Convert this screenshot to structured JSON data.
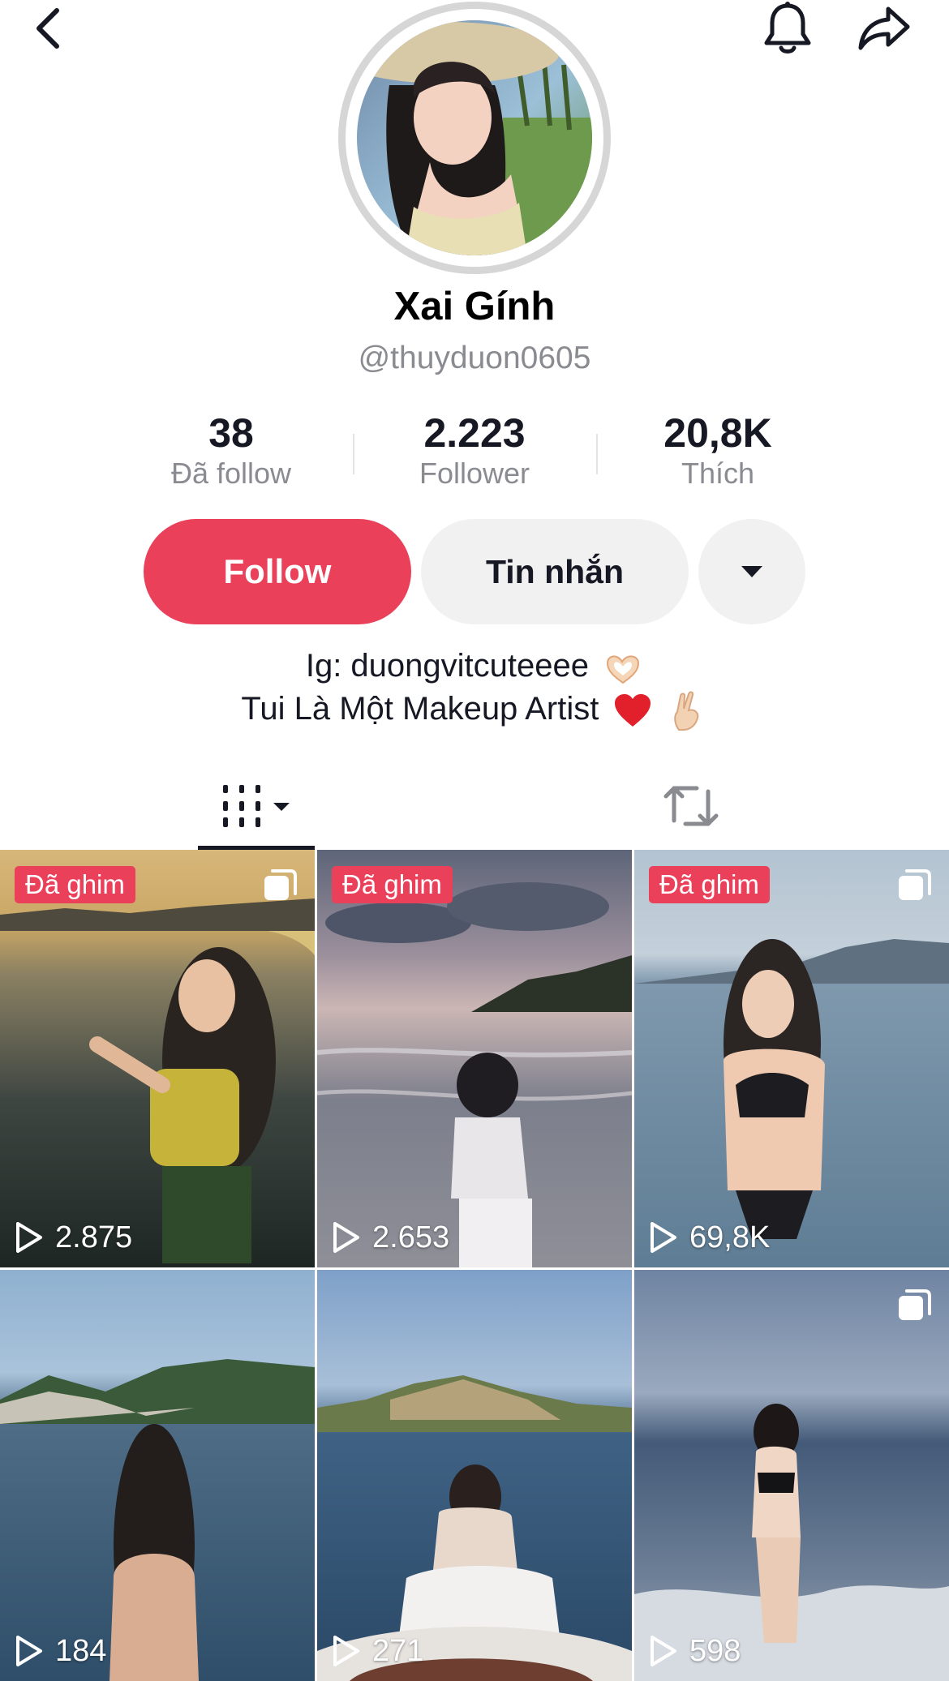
{
  "header": {
    "back_icon": "chevron-left-icon",
    "bell_icon": "bell-icon",
    "share_icon": "share-arrow-icon"
  },
  "profile": {
    "display_name": "Xai Gính",
    "handle": "@thuyduon0605",
    "avatar": "profile-photo"
  },
  "stats": [
    {
      "value": "38",
      "label": "Đã follow"
    },
    {
      "value": "2.223",
      "label": "Follower"
    },
    {
      "value": "20,8K",
      "label": "Thích"
    }
  ],
  "actions": {
    "follow_label": "Follow",
    "message_label": "Tin nhắn",
    "more_icon": "caret-down-icon"
  },
  "bio": {
    "line1": "Ig: duongvitcuteeee",
    "line1_emoji": "heart-hands-emoji",
    "line2": "Tui Là Một Makeup Artist",
    "line2_emoji": [
      "red-heart-emoji",
      "crossed-fingers-emoji"
    ]
  },
  "tabs": [
    {
      "name": "videos",
      "icon": "grid-lines-icon",
      "has_dropdown": true,
      "active": true
    },
    {
      "name": "reposts",
      "icon": "repost-icon",
      "active": false
    }
  ],
  "videos": [
    {
      "views": "2.875",
      "pinned": true,
      "pin_label": "Đã ghim",
      "multi": true
    },
    {
      "views": "2.653",
      "pinned": true,
      "pin_label": "Đã ghim",
      "multi": false
    },
    {
      "views": "69,8K",
      "pinned": true,
      "pin_label": "Đã ghim",
      "multi": true
    },
    {
      "views": "184",
      "pinned": false,
      "pin_label": "",
      "multi": false
    },
    {
      "views": "271",
      "pinned": false,
      "pin_label": "",
      "multi": false
    },
    {
      "views": "598",
      "pinned": false,
      "pin_label": "",
      "multi": true
    }
  ],
  "colors": {
    "accent": "#ea405a",
    "text_primary": "#161823",
    "text_secondary": "#8a8b91",
    "button_secondary_bg": "#f1f1f2"
  }
}
